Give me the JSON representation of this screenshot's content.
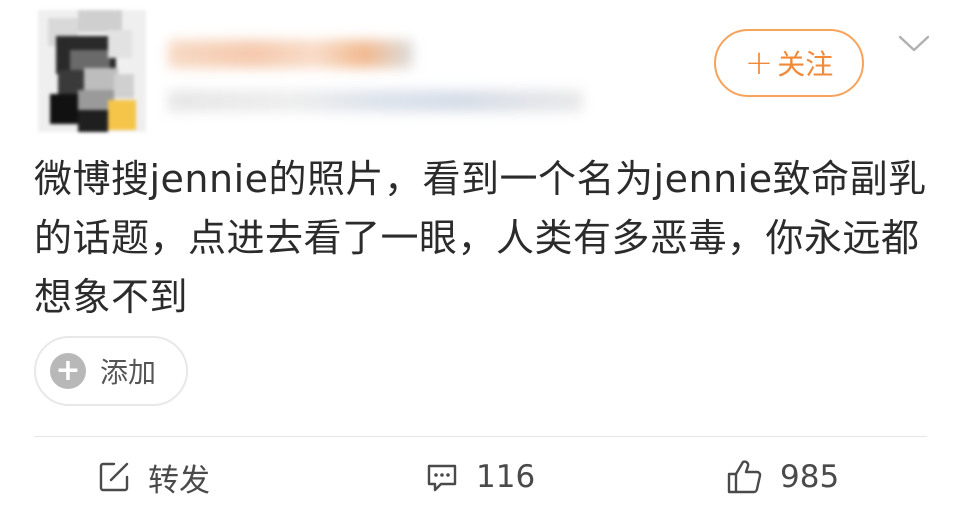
{
  "header": {
    "follow_button": {
      "plus": "+",
      "label": "关注"
    }
  },
  "post": {
    "text": "微博搜jennie的照片，看到一个名为jennie致命副乳的话题，点进去看了一眼，人类有多恶毒，你永远都想象不到"
  },
  "tag_chip": {
    "plus": "+",
    "label": "添加"
  },
  "actions": {
    "repost_label": "转发",
    "comment_count": "116",
    "like_count": "985"
  },
  "colors": {
    "accent": "#f08a3a",
    "follow_border": "#f7a35c",
    "chip_icon": "#b8b8b8",
    "divider": "#e6e6e6"
  },
  "icons": {
    "repost": "edit-square-icon",
    "comment": "comment-bubble-icon",
    "like": "thumbs-up-icon",
    "more": "chevron-down-icon"
  }
}
